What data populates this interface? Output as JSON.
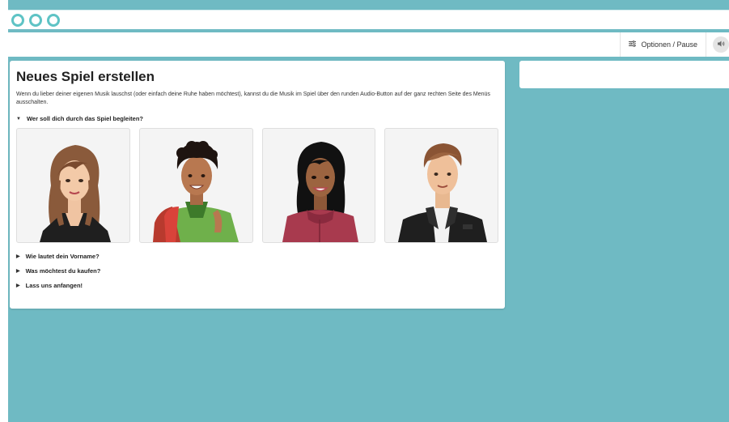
{
  "menubar": {
    "options_label": "Optionen / Pause",
    "options_icon": "sliders-icon",
    "audio_icon": "speaker-icon"
  },
  "main": {
    "title": "Neues Spiel erstellen",
    "intro": "Wenn du lieber deiner eigenen Musik lauschst (oder einfach deine Ruhe haben möchtest), kannst du die Musik im Spiel über den runden Audio-Button auf der ganz rechten Seite des Menüs ausschalten.",
    "sections": [
      {
        "label": "Wer soll dich durch das Spiel begleiten?",
        "expanded": true
      },
      {
        "label": "Wie lautet dein Vorname?",
        "expanded": false
      },
      {
        "label": "Was möchtest du kaufen?",
        "expanded": false
      },
      {
        "label": "Lass uns anfangen!",
        "expanded": false
      }
    ],
    "characters": [
      {
        "icon": "woman-long-hair-avatar"
      },
      {
        "icon": "man-curly-hair-backpack-avatar"
      },
      {
        "icon": "woman-dark-hair-hoodie-avatar"
      },
      {
        "icon": "man-leather-jacket-avatar"
      }
    ]
  },
  "colors": {
    "background": "#6fbac3",
    "accent": "#5ec3c5",
    "panel": "#ffffff"
  }
}
